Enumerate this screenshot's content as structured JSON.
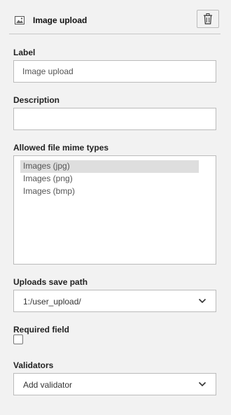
{
  "header": {
    "title": "Image upload",
    "icon": "image-icon",
    "delete_icon": "trash-icon"
  },
  "fields": {
    "label": {
      "label": "Label",
      "value": "Image upload"
    },
    "description": {
      "label": "Description",
      "value": ""
    },
    "mime_types": {
      "label": "Allowed file mime types",
      "options": [
        "Images (jpg)",
        "Images (png)",
        "Images (bmp)"
      ],
      "selected": "Images (jpg)"
    },
    "save_path": {
      "label": "Uploads save path",
      "value": "1:/user_upload/"
    },
    "required": {
      "label": "Required field",
      "checked": false
    },
    "validators": {
      "label": "Validators",
      "value": "Add validator"
    }
  },
  "colors": {
    "background": "#f2f2f2",
    "border": "#bbbbbb",
    "selected_option": "#dedede"
  }
}
